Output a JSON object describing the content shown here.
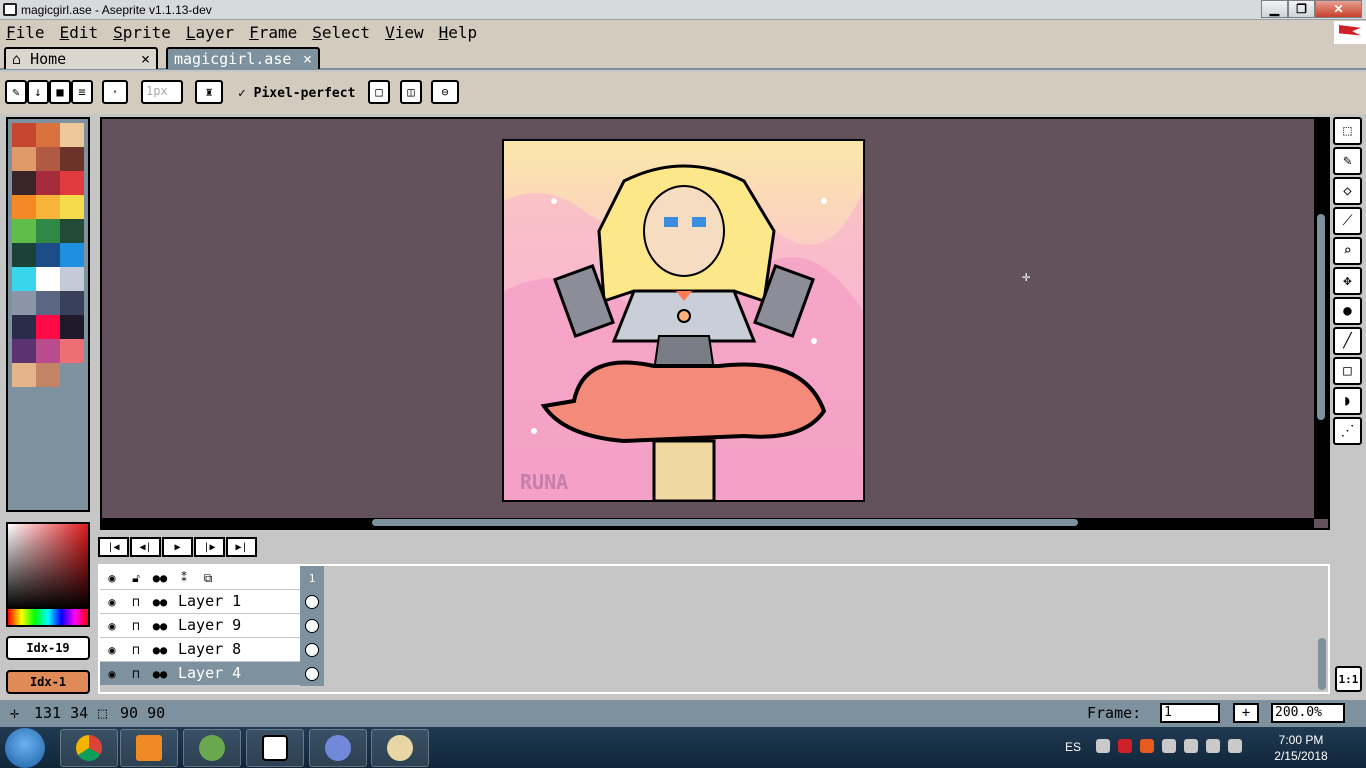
{
  "window": {
    "title": "magicgirl.ase - Aseprite v1.1.13-dev",
    "minimize": "▁",
    "restore": "❐",
    "close": "✕"
  },
  "menu": [
    "File",
    "Edit",
    "Sprite",
    "Layer",
    "Frame",
    "Select",
    "View",
    "Help"
  ],
  "tabs": [
    {
      "label": "Home",
      "icon": "home-icon",
      "close": "×"
    },
    {
      "label": "magicgirl.ase",
      "close": "×"
    }
  ],
  "contextbar": {
    "brush_size_placeholder": "1px",
    "pixel_perfect_label": "Pixel-perfect",
    "pixel_perfect_checked": true
  },
  "palette": {
    "colors": [
      "#c5452f",
      "#d9713e",
      "#ecc89a",
      "#e09a69",
      "#b05a43",
      "#6e3328",
      "#3a262a",
      "#a52a3a",
      "#e03a3f",
      "#f58a25",
      "#f7b33a",
      "#f6db4a",
      "#5fbd49",
      "#2f8843",
      "#234a35",
      "#1c4238",
      "#1c4d86",
      "#1f8fe0",
      "#37d6ec",
      "#ffffff",
      "#c4cbd8",
      "#8a96a8",
      "#5a6682",
      "#39405a",
      "#2a2d4a",
      "#ff0a47",
      "#1e1a2b",
      "#5c3270",
      "#b84c8c",
      "#ef6e74",
      "#e3b48a",
      "#c38466"
    ]
  },
  "colors": {
    "fg_label": "Idx-19",
    "bg_label": "Idx-1",
    "bg_color": "#e08a57"
  },
  "sprite": {
    "signature": "RUNA"
  },
  "timeline": {
    "frame_header": "1",
    "layers": [
      {
        "name": "Layer 1"
      },
      {
        "name": "Layer 9"
      },
      {
        "name": "Layer 8"
      },
      {
        "name": "Layer 4",
        "selected": true
      }
    ]
  },
  "statusbar": {
    "cursor_pos": "131 34",
    "sprite_size": "90 90",
    "frame_label": "Frame:",
    "frame_value": "1",
    "add_label": "+",
    "zoom_value": "200.0%"
  },
  "zoom_reset_label": "1:1",
  "taskbar": {
    "lang": "ES",
    "time": "7:00 PM",
    "date": "2/15/2018"
  }
}
